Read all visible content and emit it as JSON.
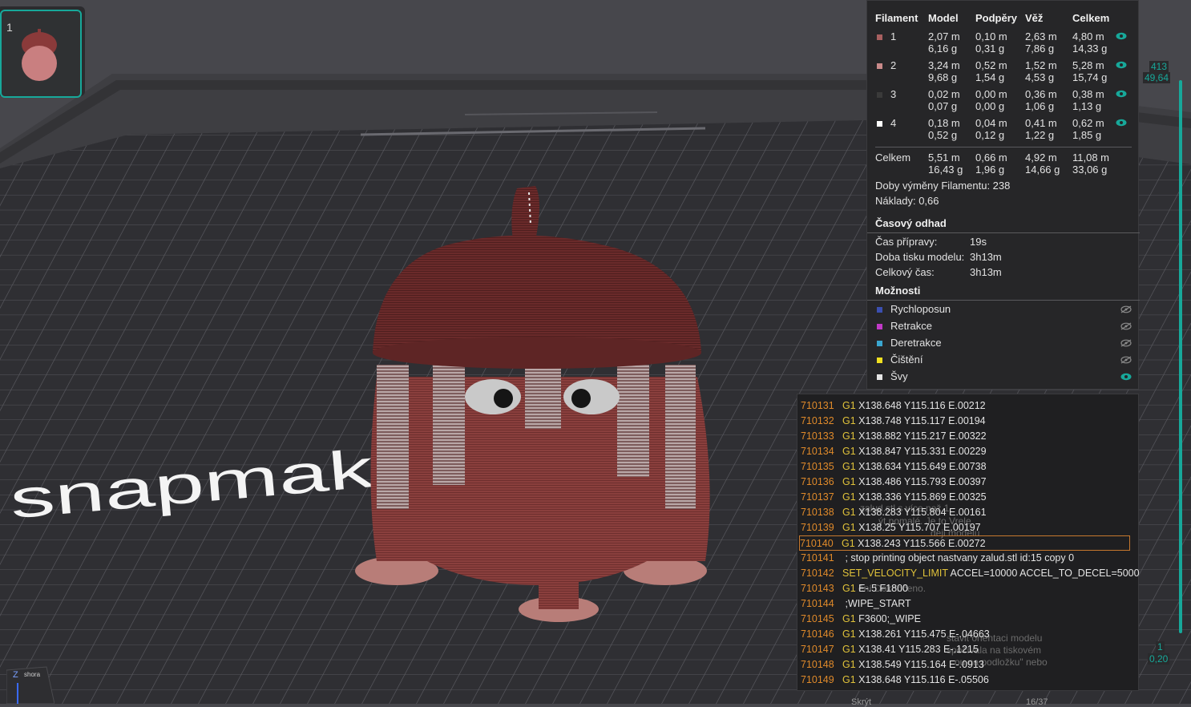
{
  "plate": {
    "number": "1"
  },
  "stats": {
    "headers": [
      "Filament",
      "Model",
      "Podpěry",
      "Věž",
      "Celkem"
    ],
    "rows": [
      {
        "id": "1",
        "color": "#a86060",
        "model": [
          "2,07 m",
          "6,16 g"
        ],
        "supports": [
          "0,10 m",
          "0,31 g"
        ],
        "tower": [
          "2,63 m",
          "7,86 g"
        ],
        "total": [
          "4,80 m",
          "14,33 g"
        ],
        "visible": true
      },
      {
        "id": "2",
        "color": "#c98a8a",
        "model": [
          "3,24 m",
          "9,68 g"
        ],
        "supports": [
          "0,52 m",
          "1,54 g"
        ],
        "tower": [
          "1,52 m",
          "4,53 g"
        ],
        "total": [
          "5,28 m",
          "15,74 g"
        ],
        "visible": true
      },
      {
        "id": "3",
        "color": "#3a3a3a",
        "model": [
          "0,02 m",
          "0,07 g"
        ],
        "supports": [
          "0,00 m",
          "0,00 g"
        ],
        "tower": [
          "0,36 m",
          "1,06 g"
        ],
        "total": [
          "0,38 m",
          "1,13 g"
        ],
        "visible": true
      },
      {
        "id": "4",
        "color": "#ffffff",
        "model": [
          "0,18 m",
          "0,52 g"
        ],
        "supports": [
          "0,04 m",
          "0,12 g"
        ],
        "tower": [
          "0,41 m",
          "1,22 g"
        ],
        "total": [
          "0,62 m",
          "1,85 g"
        ],
        "visible": true
      }
    ],
    "total_row": {
      "label": "Celkem",
      "model": [
        "5,51 m",
        "16,43 g"
      ],
      "supports": [
        "0,66 m",
        "1,96 g"
      ],
      "tower": [
        "4,92 m",
        "14,66 g"
      ],
      "total": [
        "11,08 m",
        "33,06 g"
      ]
    },
    "filament_changes": "Doby výměny Filamentu:  238",
    "cost": "Náklady:  0,66",
    "time_title": "Časový odhad",
    "prep_label": "Čas přípravy:",
    "prep_value": "19s",
    "print_label": "Doba tisku modelu:",
    "print_value": "3h13m",
    "total_label": "Celkový čas:",
    "total_value": "3h13m",
    "options_title": "Možnosti",
    "options": [
      {
        "label": "Rychloposun",
        "color": "#3b4fb0",
        "visible": false
      },
      {
        "label": "Retrakce",
        "color": "#c23ac8",
        "visible": false
      },
      {
        "label": "Deretrakce",
        "color": "#3aa6d0",
        "visible": false
      },
      {
        "label": "Čištění",
        "color": "#f0e020",
        "visible": false
      },
      {
        "label": "Švy",
        "color": "#e6e6e6",
        "visible": true
      }
    ]
  },
  "slider": {
    "top_value": "413",
    "top_height": "49,64",
    "bottom_value": "1",
    "bottom_height": "0,20"
  },
  "gcode": {
    "lines": [
      {
        "n": "710131",
        "cmd": "G1",
        "rest": " X138.648 Y115.116 E.00212"
      },
      {
        "n": "710132",
        "cmd": "G1",
        "rest": " X138.748 Y115.117 E.00194"
      },
      {
        "n": "710133",
        "cmd": "G1",
        "rest": " X138.882 Y115.217 E.00322"
      },
      {
        "n": "710134",
        "cmd": "G1",
        "rest": " X138.847 Y115.331 E.00229"
      },
      {
        "n": "710135",
        "cmd": "G1",
        "rest": " X138.634 Y115.649 E.00738"
      },
      {
        "n": "710136",
        "cmd": "G1",
        "rest": " X138.486 Y115.793 E.00397"
      },
      {
        "n": "710137",
        "cmd": "G1",
        "rest": " X138.336 Y115.869 E.00325"
      },
      {
        "n": "710138",
        "cmd": "G1",
        "rest": " X138.283 Y115.804 E.00161"
      },
      {
        "n": "710139",
        "cmd": "G1",
        "rest": " X138.25 Y115.707 E.00197"
      },
      {
        "n": "710140",
        "cmd": "G1",
        "rest": " X138.243 Y115.566 E.00272"
      },
      {
        "n": "710141",
        "cmd": "",
        "rest": " ; stop printing object nastvany zalud.stl id:15 copy 0"
      },
      {
        "n": "710142",
        "cmd": "SET_VELOCITY_LIMIT",
        "rest": " ACCEL=10000 ACCEL_TO_DECEL=5000"
      },
      {
        "n": "710143",
        "cmd": "G1",
        "rest": " E-.5 F1800"
      },
      {
        "n": "710144",
        "cmd": "",
        "rest": " ;WIPE_START"
      },
      {
        "n": "710145",
        "cmd": "G1",
        "rest": " F3600;_WIPE"
      },
      {
        "n": "710146",
        "cmd": "G1",
        "rest": " X138.261 Y115.475 E-.04663"
      },
      {
        "n": "710147",
        "cmd": "G1",
        "rest": " X138.41 Y115.283 E-.1215"
      },
      {
        "n": "710148",
        "cmd": "G1",
        "rest": " X138.549 Y115.164 E-.0913"
      },
      {
        "n": "710149",
        "cmd": "G1",
        "rest": " X138.648 Y115.116 E-.05506"
      }
    ],
    "selected_index": 9
  },
  "axis": {
    "z_label": "Z",
    "view_label": "shora"
  },
  "bottom": {
    "hint": "Skrýt",
    "pager": "16/37"
  },
  "brand": "snapmaker"
}
